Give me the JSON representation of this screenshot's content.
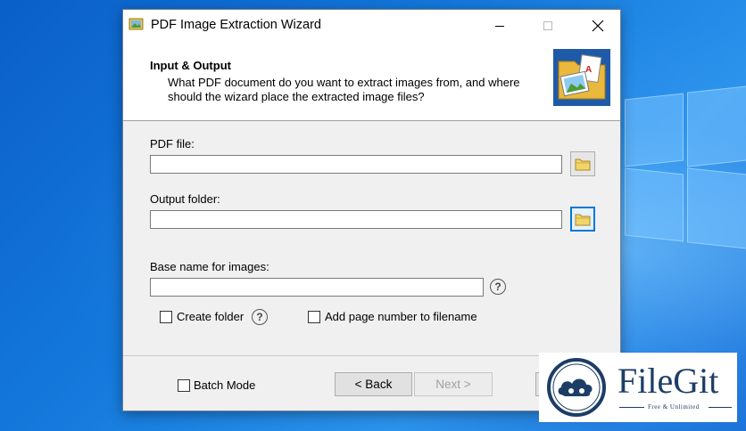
{
  "window": {
    "title": "PDF Image Extraction Wizard"
  },
  "header": {
    "title": "Input & Output",
    "description": "What PDF document do you want to extract images from, and where should the wizard place the extracted image files?"
  },
  "form": {
    "pdf_file_label": "PDF file:",
    "pdf_file_value": "",
    "output_folder_label": "Output folder:",
    "output_folder_value": "",
    "base_name_label": "Base name for images:",
    "base_name_value": "",
    "create_folder_label": "Create folder",
    "create_folder_checked": false,
    "add_page_number_label": "Add page number to filename",
    "add_page_number_checked": false,
    "help_glyph": "?"
  },
  "footer": {
    "batch_mode_label": "Batch Mode",
    "batch_mode_checked": false,
    "back_label": "< Back",
    "next_label": "Next >"
  },
  "watermark": {
    "name": "FileGit",
    "tagline": "Free & Unlimited"
  },
  "icons": {
    "app": "pdf-image-app-icon",
    "header": "folder-pdf-image-icon",
    "browse": "folder-icon",
    "help": "question-icon"
  },
  "colors": {
    "dialog_bg": "#f0f0f0",
    "focus": "#0078d7",
    "desktop": "#1479dc",
    "watermark": "#1c3d66"
  }
}
